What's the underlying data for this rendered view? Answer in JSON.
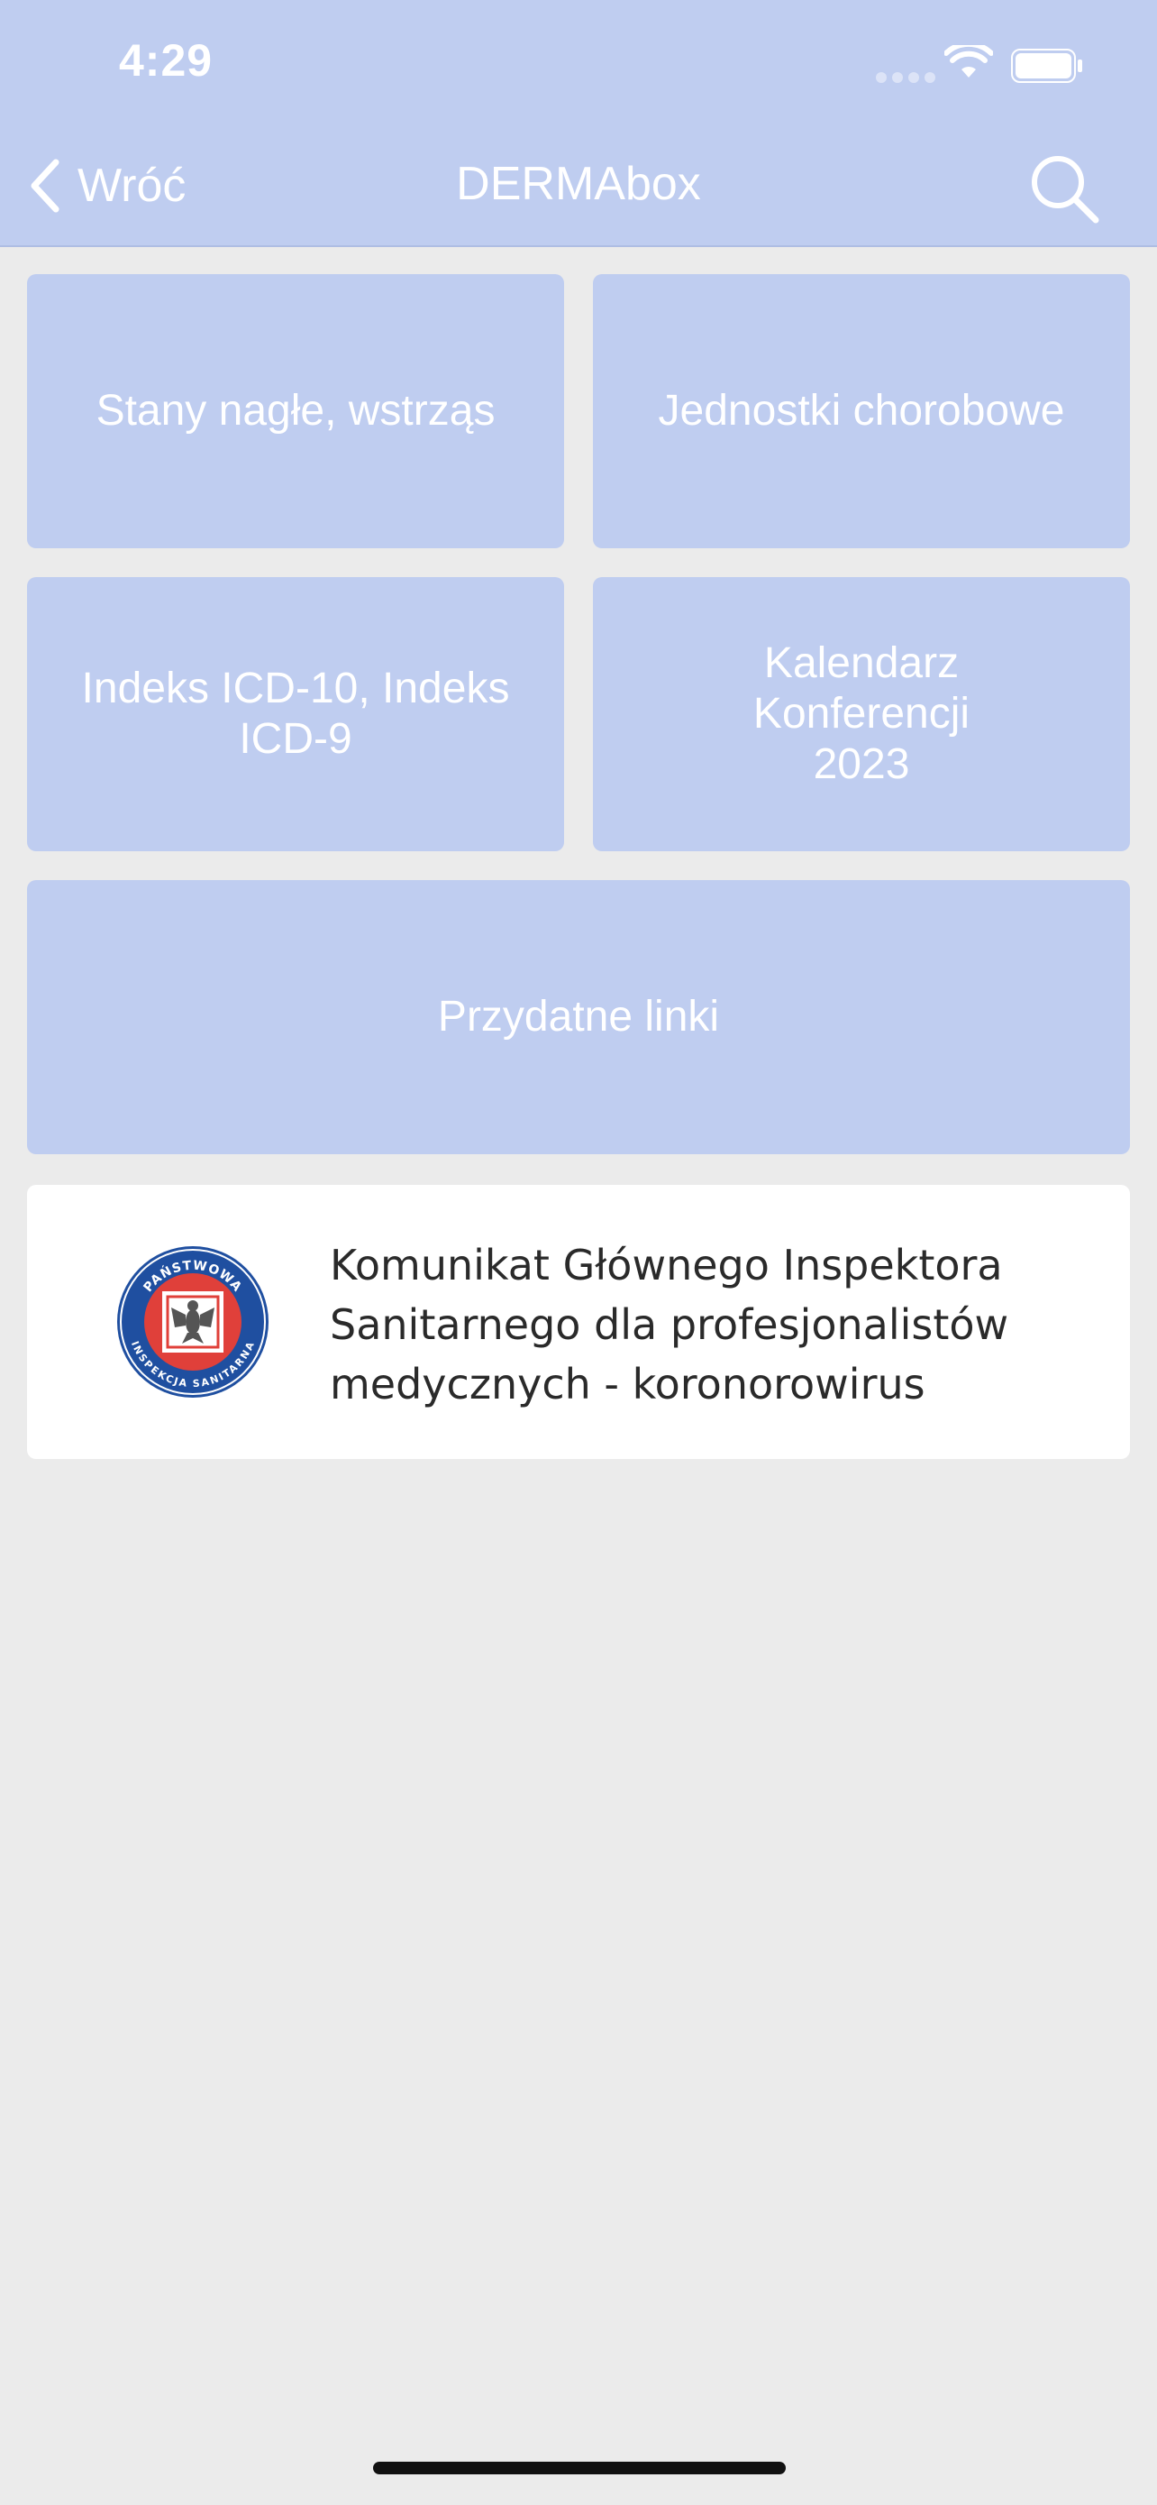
{
  "status_bar": {
    "time": "4:29"
  },
  "nav": {
    "back_label": "Wróć",
    "title": "DERMAbox"
  },
  "tiles": [
    {
      "label": "Stany nagłe, wstrząs"
    },
    {
      "label": "Jednostki chorobowe"
    },
    {
      "label": "Indeks ICD-10, Indeks ICD-9"
    },
    {
      "label": "Kalendarz Konferencji 2023"
    },
    {
      "label": "Przydatne linki"
    }
  ],
  "notice": {
    "text": "Komunikat  Głównego Inspektora\nSanitarnego dla profesjonalistów\nmedycznych - koronorowirus",
    "logo_text_top": "PAŃSTWOWA",
    "logo_text_bottom": "INSPEKCJA SANITARNA"
  },
  "colors": {
    "accent": "#bfcdf0",
    "background": "#ebebeb",
    "card": "#ffffff",
    "logo_blue": "#1f4fa0",
    "logo_red": "#e0403a"
  },
  "icons": {
    "back": "chevron-left-icon",
    "search": "magnifier-icon",
    "wifi": "wifi-icon",
    "battery": "battery-icon",
    "logo": "sanitary-inspection-emblem"
  }
}
